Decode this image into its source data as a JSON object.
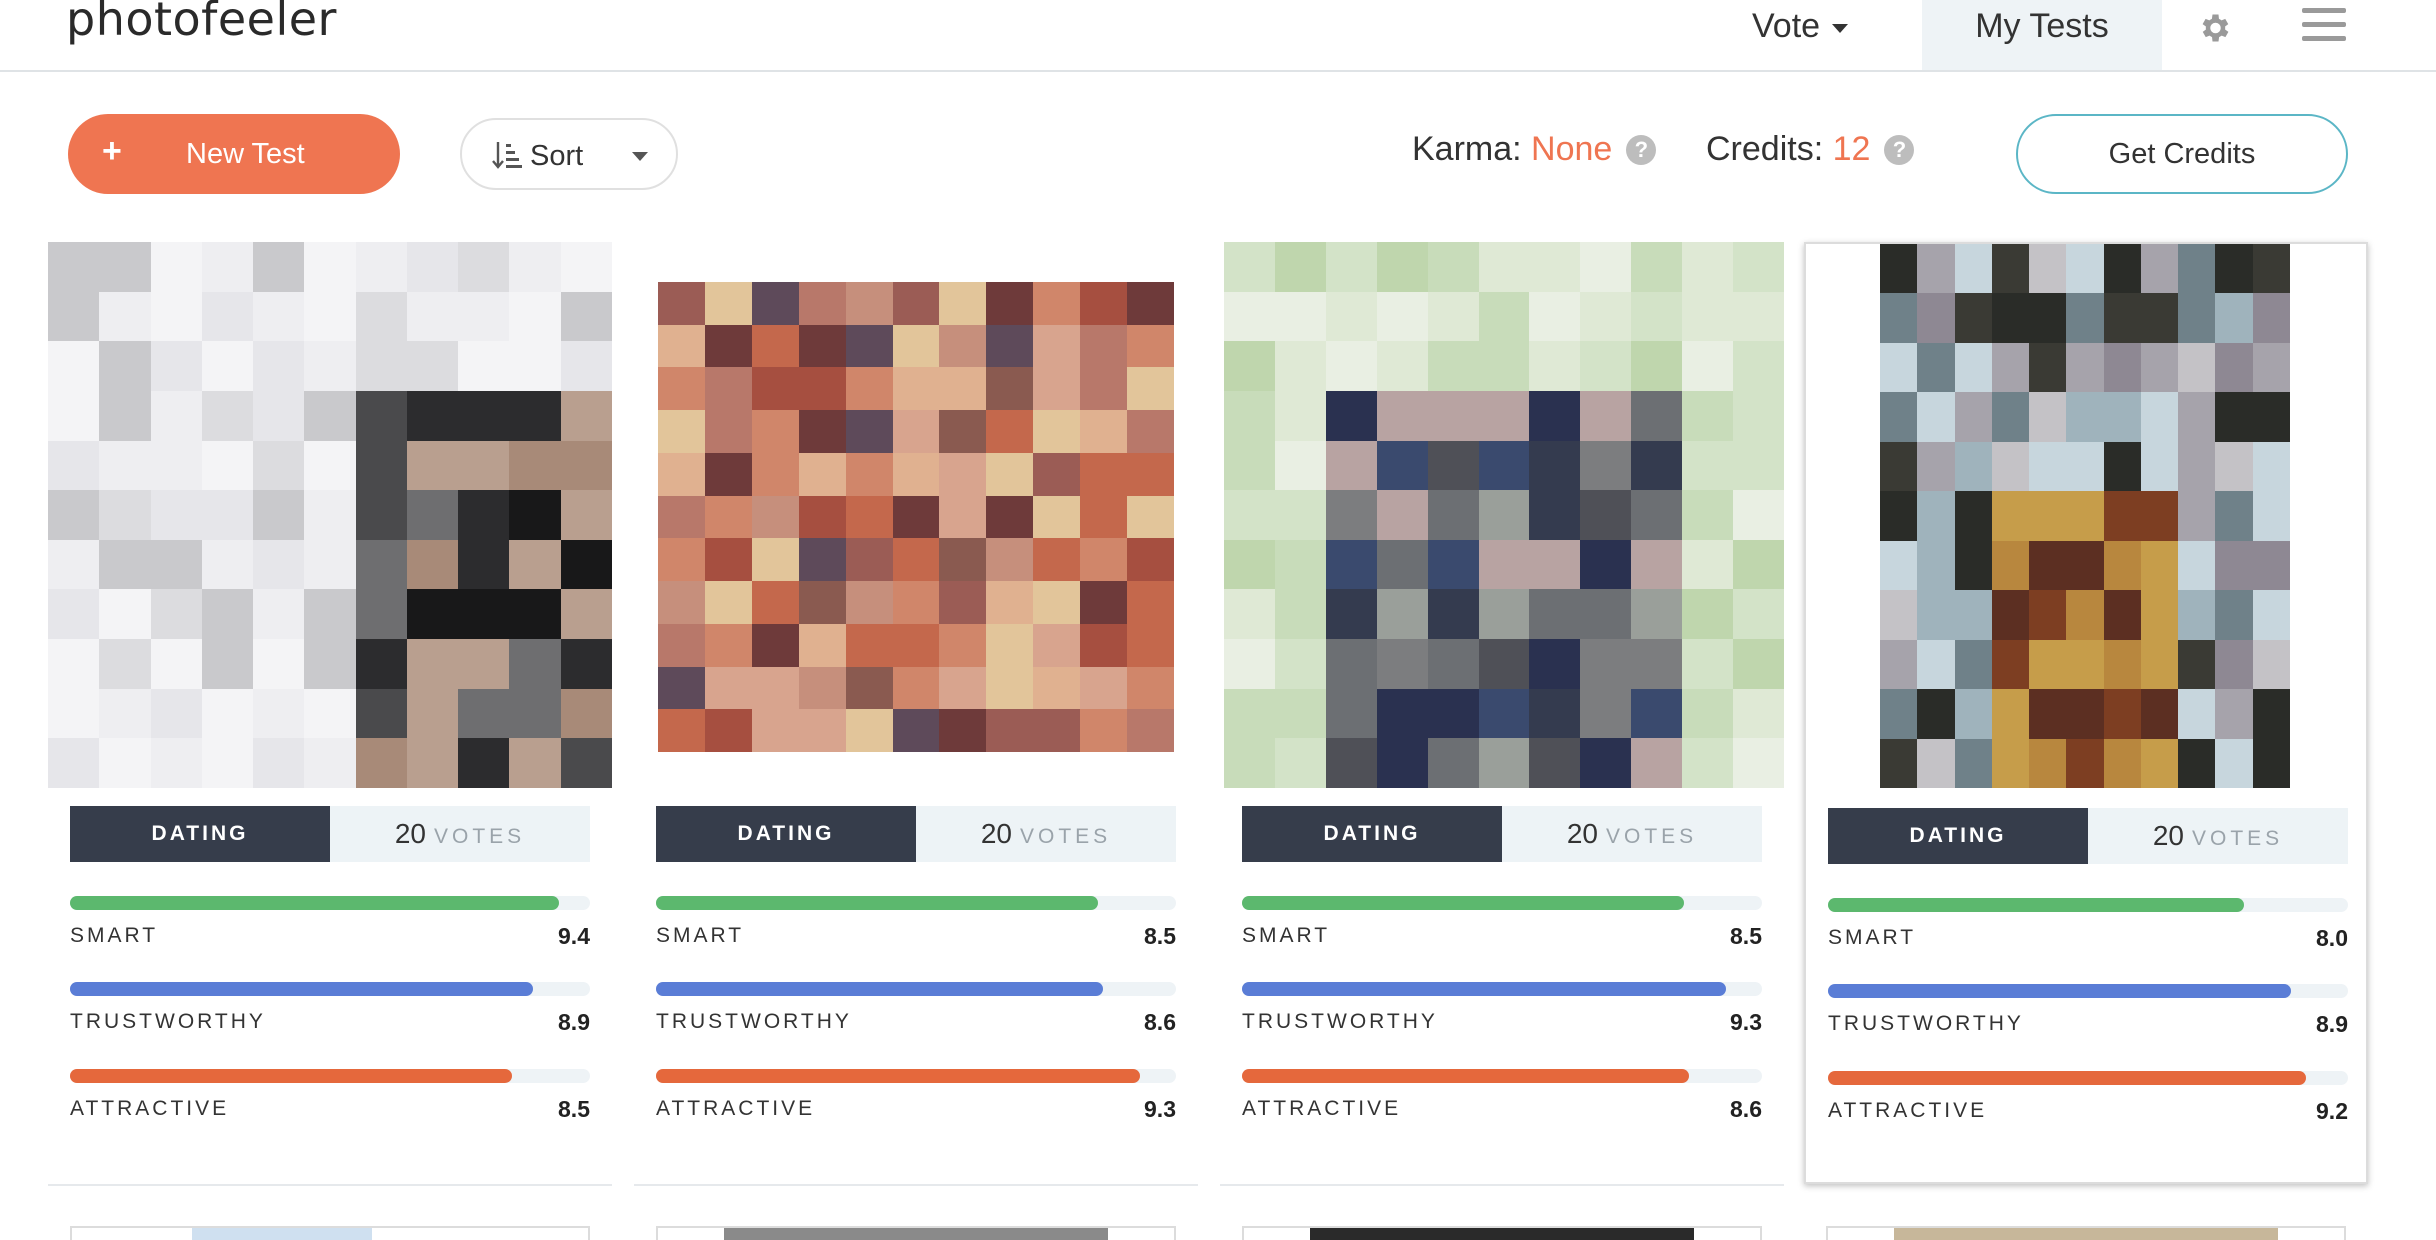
{
  "header": {
    "logo": "photofeeler",
    "nav_vote": "Vote",
    "nav_my_tests": "My Tests",
    "icons": [
      "gear-icon",
      "menu-icon"
    ]
  },
  "toolbar": {
    "new_test_icon": "+",
    "new_test": "New Test",
    "sort": "Sort",
    "karma_label": "Karma:",
    "karma_value": "None",
    "credits_label": "Credits:",
    "credits_value": "12",
    "help_glyph": "?",
    "get_credits": "Get Credits"
  },
  "colors": {
    "accent": "#ef7551",
    "smart": "#5cb86e",
    "trustworthy": "#5a7dd6",
    "attractive": "#e5683c",
    "badge": "#363d4b"
  },
  "cards": [
    {
      "category": "DATING",
      "votes": "20",
      "votes_label": "VOTES",
      "metrics": [
        {
          "label": "SMART",
          "value": "9.4",
          "level": 0.94
        },
        {
          "label": "TRUSTWORTHY",
          "value": "8.9",
          "level": 0.89
        },
        {
          "label": "ATTRACTIVE",
          "value": "8.5",
          "level": 0.85
        }
      ]
    },
    {
      "category": "DATING",
      "votes": "20",
      "votes_label": "VOTES",
      "metrics": [
        {
          "label": "SMART",
          "value": "8.5",
          "level": 0.85
        },
        {
          "label": "TRUSTWORTHY",
          "value": "8.6",
          "level": 0.86
        },
        {
          "label": "ATTRACTIVE",
          "value": "9.3",
          "level": 0.93
        }
      ]
    },
    {
      "category": "DATING",
      "votes": "20",
      "votes_label": "VOTES",
      "metrics": [
        {
          "label": "SMART",
          "value": "8.5",
          "level": 0.85
        },
        {
          "label": "TRUSTWORTHY",
          "value": "9.3",
          "level": 0.93
        },
        {
          "label": "ATTRACTIVE",
          "value": "8.6",
          "level": 0.86
        }
      ]
    },
    {
      "category": "DATING",
      "votes": "20",
      "votes_label": "VOTES",
      "metrics": [
        {
          "label": "SMART",
          "value": "8.0",
          "level": 0.8
        },
        {
          "label": "TRUSTWORTHY",
          "value": "8.9",
          "level": 0.89
        },
        {
          "label": "ATTRACTIVE",
          "value": "9.2",
          "level": 0.92
        }
      ]
    }
  ]
}
